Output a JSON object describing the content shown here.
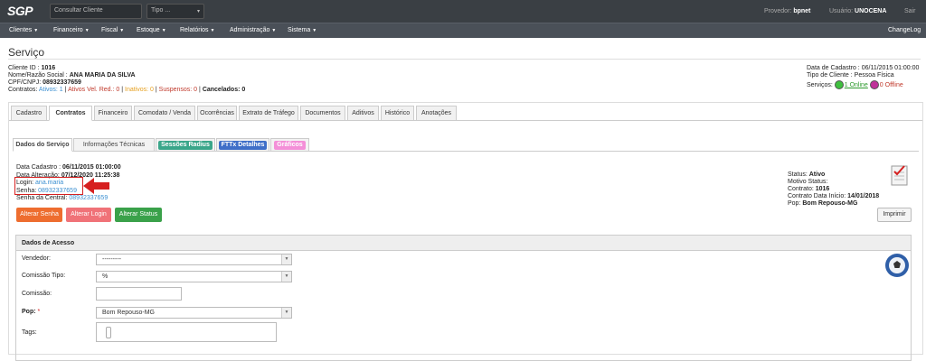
{
  "topbar": {
    "logo": "SGP",
    "search_placeholder": "Consultar Cliente",
    "type_select": "Tipo ...",
    "provider_label": "Provedor:",
    "provider_value": "bpnet",
    "user_label": "Usuário:",
    "user_value": "UNOCENA",
    "logout": "Sair"
  },
  "nav": {
    "items": [
      "Clientes",
      "Financeiro",
      "Fiscal",
      "Estoque",
      "Relatórios",
      "Administração",
      "Sistema"
    ],
    "changelog": "ChangeLog"
  },
  "page_title": "Serviço",
  "client": {
    "id_label": "Cliente ID :",
    "id_value": "1016",
    "name_label": "Nome/Razão Social :",
    "name_value": "ANA MARIA DA SILVA",
    "doc_label": "CPF/CNPJ:",
    "doc_value": "08932337659",
    "contracts_label": "Contratos:",
    "ativos": "Ativos: 1",
    "ativos_red": "Ativos Vel. Red.: 0",
    "inativos": "Inativos: 0",
    "suspensos": "Suspensos: 0",
    "cancelados": "Cancelados: 0",
    "sep": "|",
    "created_label": "Data de Cadastro :",
    "created_value": "06/11/2015 01:00:00",
    "type_label": "Tipo de Cliente :",
    "type_value": "Pessoa Física",
    "services_label": "Serviços:",
    "online": "1 Online",
    "offline": "0 Offline"
  },
  "tabs": [
    "Cadastro",
    "Contratos",
    "Financeiro",
    "Comodato / Venda",
    "Ocorrências",
    "Extrato de Tráfego",
    "Documentos",
    "Aditivos",
    "Histórico",
    "Anotações"
  ],
  "subtabs": {
    "dados": "Dados do Serviço",
    "info": "Informações Técnicas",
    "radius": "Sessões Radius",
    "fttx": "FTTx Detalhes",
    "graficos": "Gráficos"
  },
  "service": {
    "created_label": "Data Cadastro :",
    "created_value": "06/11/2015 01:00:00",
    "changed_label": "Data Alteração:",
    "changed_value": "07/12/2020 11:25:38",
    "login_label": "Login:",
    "login_value": "ana.maria",
    "password_label": "Senha:",
    "password_value": "08932337659",
    "central_label": "Senha da Central:",
    "central_value": "08932337659",
    "status_label": "Status:",
    "status_value": "Ativo",
    "reason_label": "Motivo Status:",
    "reason_value": "",
    "contract_label": "Contrato:",
    "contract_value": "1016",
    "start_label": "Contrato Data Início:",
    "start_value": "14/01/2018",
    "pop_label": "Pop:",
    "pop_value": "Bom Repouso-MG"
  },
  "buttons": {
    "change_password": "Alterar Senha",
    "change_login": "Alterar Login",
    "change_status": "Alterar Status",
    "print": "Imprimir"
  },
  "access": {
    "title": "Dados de Acesso",
    "seller_label": "Vendedor:",
    "seller_value": "---------",
    "commission_type_label": "Comissão Tipo:",
    "commission_type_value": "%",
    "commission_label": "Comissão:",
    "pop_label": "Pop:",
    "pop_required": "*",
    "pop_value": "Bom Repouso-MG",
    "tags_label": "Tags:"
  },
  "colors": {
    "topbar": "#3a3f44",
    "navbar": "#4a5058",
    "highlight": "#d62020",
    "btn_orange": "#ee6d2f",
    "btn_pink": "#f07278",
    "btn_green": "#3aa14a",
    "radius_pill": "#3aa68a",
    "fttx_pill": "#3f6fc8",
    "graficos_pill": "#f48fd8"
  }
}
